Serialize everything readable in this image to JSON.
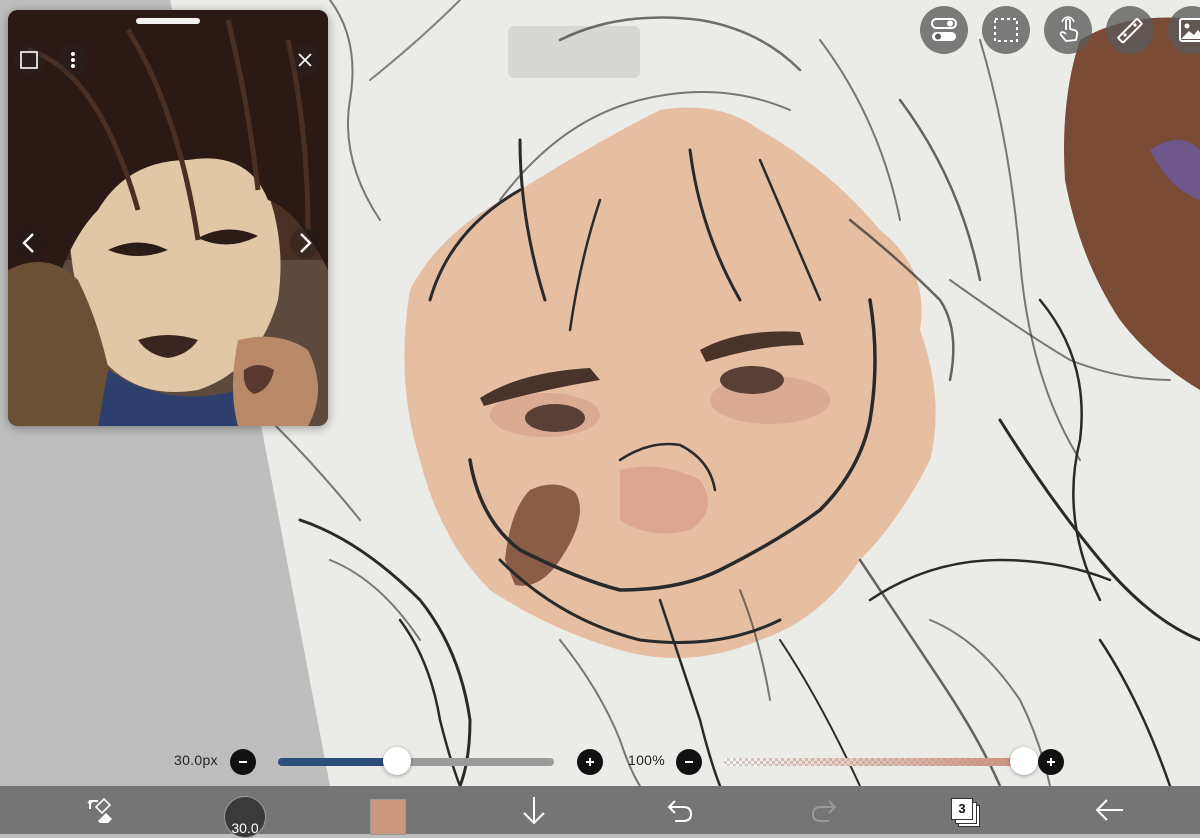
{
  "app": {
    "name": "Drawing app canvas"
  },
  "reference": {
    "icons": {
      "frame": "square-frame-icon",
      "more": "vertical-dots-icon",
      "close": "close-icon",
      "prev": "chevron-left-icon",
      "next": "chevron-right-icon"
    }
  },
  "top_tools": [
    {
      "name": "toggle-icon"
    },
    {
      "name": "selection-icon"
    },
    {
      "name": "hand-tap-icon"
    },
    {
      "name": "ruler-icon"
    },
    {
      "name": "image-icon"
    }
  ],
  "brush_size": {
    "value_label": "30.0px",
    "fraction": 0.43,
    "track_color": "#2d4e78"
  },
  "opacity": {
    "value_label": "100%",
    "fraction": 1.0,
    "color": "#c9907a"
  },
  "toolbar": {
    "brush_size_label": "30.0",
    "current_color": "#c9977e",
    "layer_count": "3",
    "icons": {
      "tool_switch": "transform-eraser-icon",
      "down": "arrow-down-icon",
      "undo": "undo-icon",
      "redo": "redo-icon",
      "layers": "layers-icon",
      "back": "arrow-left-icon"
    }
  },
  "colors": {
    "paper": "#ebebe8",
    "skin": "#e6b99a",
    "line": "#2a2a2a",
    "toolbar": "#757575"
  }
}
